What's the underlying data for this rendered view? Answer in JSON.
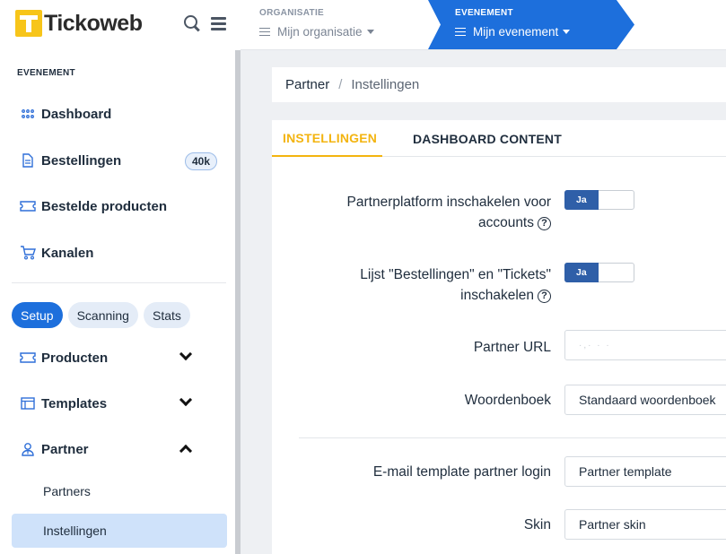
{
  "brand": {
    "name": "Tickoweb"
  },
  "sidebar": {
    "section_label": "EVENEMENT",
    "items": [
      {
        "label": "Dashboard",
        "icon": "grid-icon"
      },
      {
        "label": "Bestellingen",
        "icon": "document-icon",
        "badge": "40k"
      },
      {
        "label": "Bestelde producten",
        "icon": "ticket-icon"
      },
      {
        "label": "Kanalen",
        "icon": "cart-icon"
      }
    ],
    "pills": [
      {
        "label": "Setup",
        "active": true
      },
      {
        "label": "Scanning",
        "active": false
      },
      {
        "label": "Stats",
        "active": false
      }
    ],
    "groups": [
      {
        "label": "Producten",
        "icon": "ticket-icon",
        "expanded": false
      },
      {
        "label": "Templates",
        "icon": "layout-icon",
        "expanded": false
      },
      {
        "label": "Partner",
        "icon": "partner-icon",
        "expanded": true
      }
    ],
    "partner_sub": [
      {
        "label": "Partners",
        "active": false
      },
      {
        "label": "Instellingen",
        "active": true
      }
    ]
  },
  "header": {
    "org": {
      "caption": "ORGANISATIE",
      "value": "Mijn organisatie"
    },
    "event": {
      "caption": "EVENEMENT",
      "value": "Mijn evenement"
    }
  },
  "breadcrumb": {
    "parent": "Partner",
    "separator": "/",
    "current": "Instellingen"
  },
  "tabs": [
    {
      "label": "INSTELLINGEN",
      "active": true
    },
    {
      "label": "DASHBOARD CONTENT",
      "active": false
    }
  ],
  "form": {
    "partner_platform": {
      "label_line1": "Partnerplatform inschakelen voor",
      "label_line2": "accounts",
      "value": "Ja"
    },
    "lists_toggle": {
      "label_line1": "Lijst \"Bestellingen\" en \"Tickets\"",
      "label_line2": "inschakelen",
      "value": "Ja"
    },
    "partner_url": {
      "label": "Partner URL",
      "value": "·,·  ·  ·"
    },
    "dictionary": {
      "label": "Woordenboek",
      "value": "Standaard woordenboek"
    },
    "email_template": {
      "label": "E-mail template partner login",
      "value": "Partner template"
    },
    "skin": {
      "label": "Skin",
      "value": "Partner skin"
    }
  },
  "colors": {
    "primary": "#1d6fdc",
    "accent": "#f3b410",
    "toggle_on": "#2f5fa8",
    "brand_yellow": "#f7c51a"
  }
}
